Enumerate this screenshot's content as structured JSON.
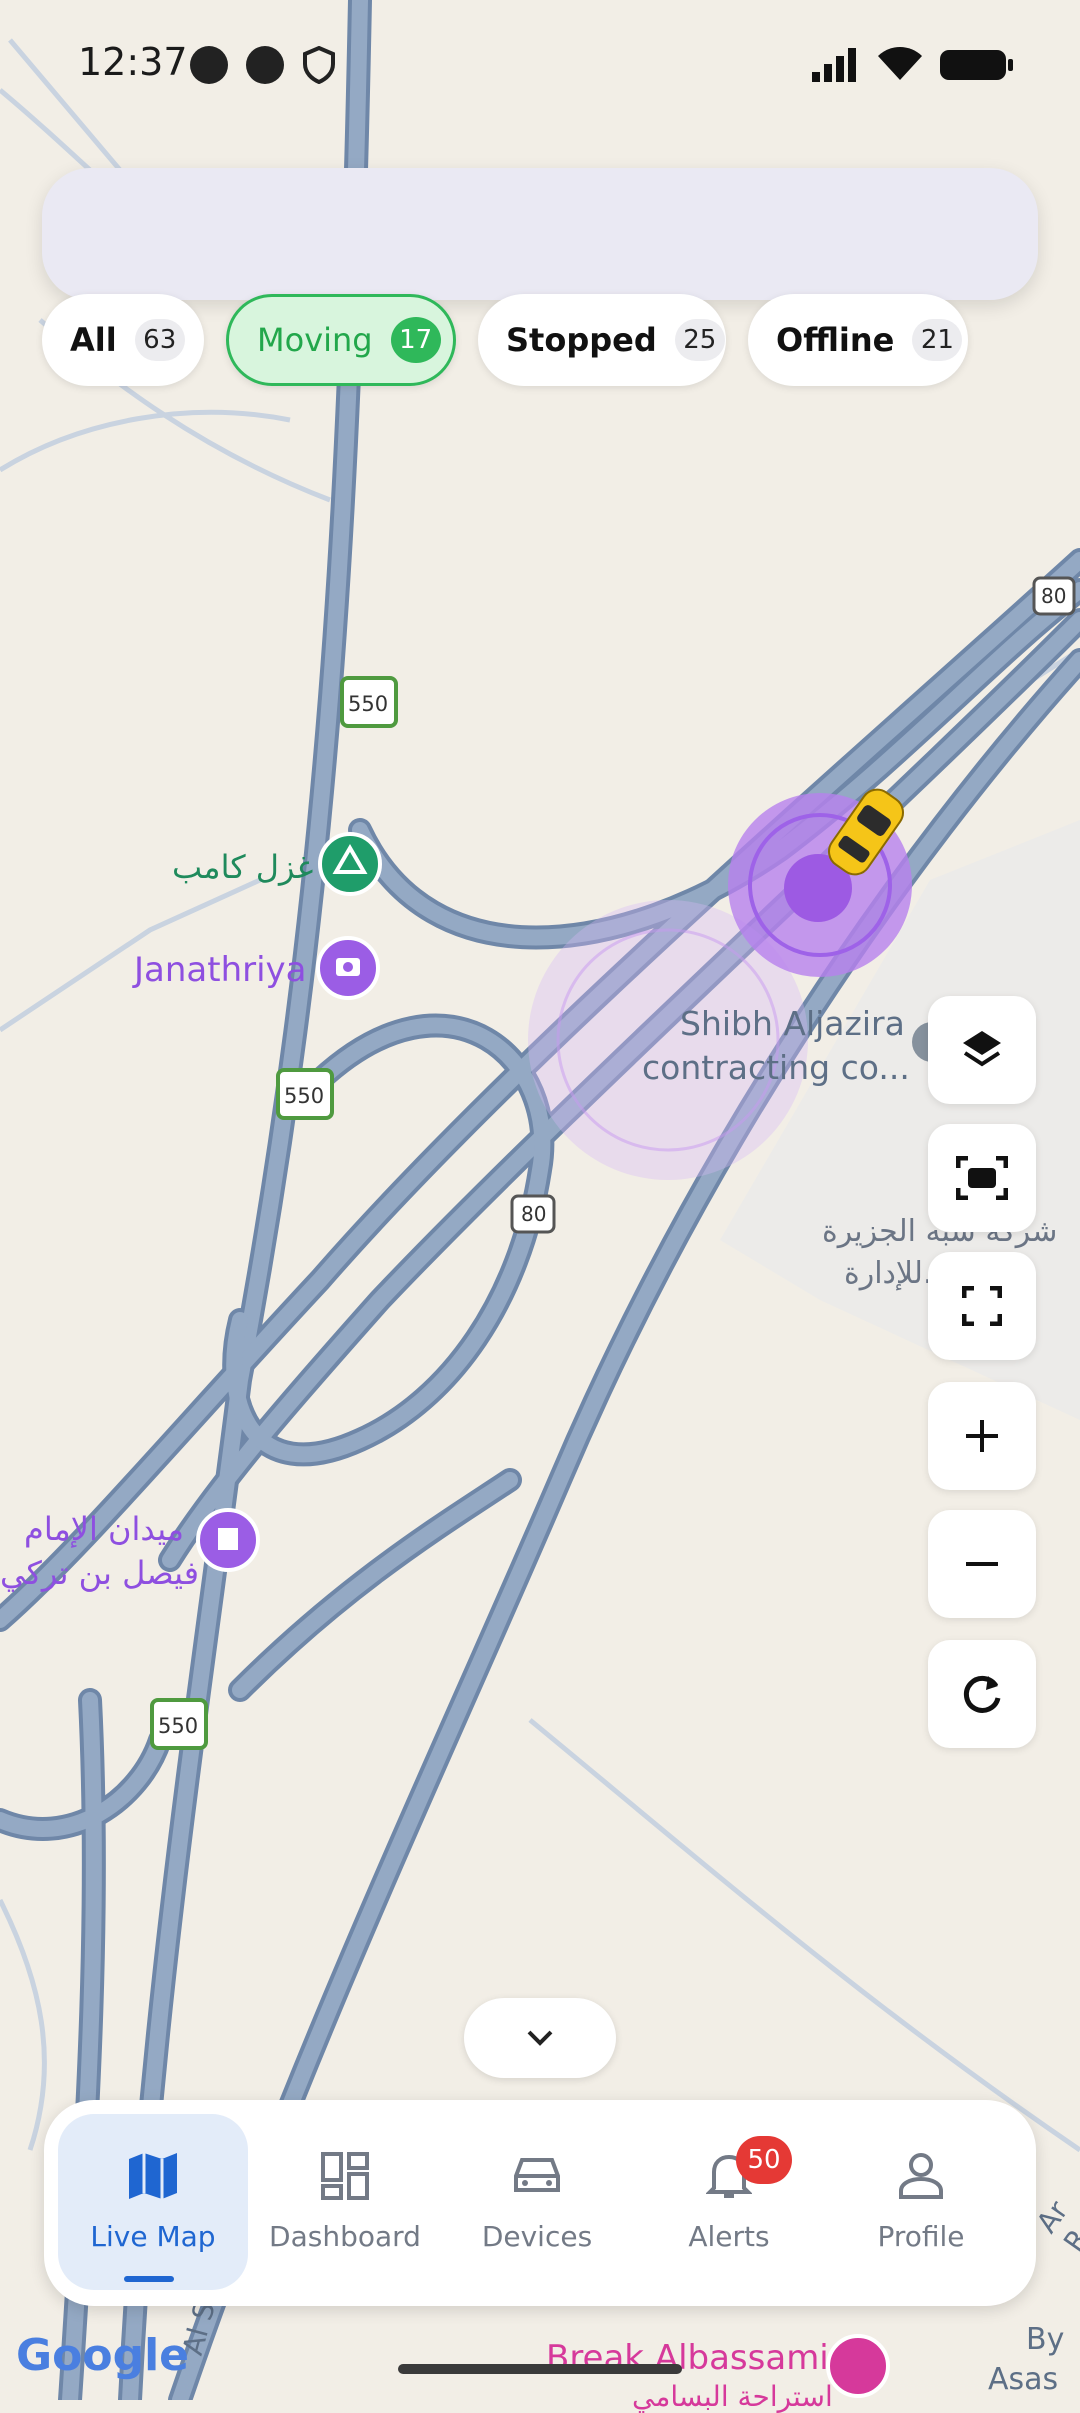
{
  "status_bar": {
    "time": "12:37"
  },
  "search": {
    "placeholder": ""
  },
  "filters": [
    {
      "label": "All",
      "count": "63"
    },
    {
      "label": "Moving",
      "count": "17"
    },
    {
      "label": "Stopped",
      "count": "25"
    },
    {
      "label": "Offline",
      "count": "21"
    }
  ],
  "map": {
    "place_ghazl_camp": "غزل كامب",
    "place_janathriya": "Janathriya",
    "place_shibh_line1": "Shibh Aljazira",
    "place_shibh_line2": "contracting co...",
    "place_arabic_building_line1": "شركة شبه الجزيرة",
    "place_arabic_building_line2": "للإدارة...",
    "place_square_line1": "ميدان الإمام",
    "place_square_line2": "فيصل بن تركي",
    "place_break": "Break Albassami",
    "place_break_sub": "استراحة البسامي",
    "road_80": "80",
    "road_550": "550",
    "corner_by": "By",
    "corner_asas": "Asas",
    "road_ar": "Ar R",
    "road_al": "Al S",
    "google": "Google"
  },
  "map_controls": [
    "layers-icon",
    "fit-bounds-icon",
    "fullscreen-icon",
    "zoom-in-icon",
    "zoom-out-icon",
    "refresh-icon"
  ],
  "bottom_nav": {
    "items": [
      {
        "label": "Live Map",
        "icon": "map-icon"
      },
      {
        "label": "Dashboard",
        "icon": "dashboard-icon"
      },
      {
        "label": "Devices",
        "icon": "car-icon"
      },
      {
        "label": "Alerts",
        "icon": "bell-icon",
        "badge": "50"
      },
      {
        "label": "Profile",
        "icon": "person-icon"
      }
    ]
  },
  "colors": {
    "accent": "#1f66d1",
    "moving": "#2fb85a",
    "alert_badge": "#e53935",
    "road": "#8aa0bd",
    "poi_purple": "#9b5de5",
    "poi_green": "#1f9d6a"
  }
}
